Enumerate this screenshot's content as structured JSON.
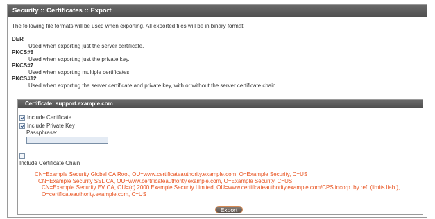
{
  "header": {
    "title": "Security :: Certificates :: Export"
  },
  "intro": "The following file formats will be used when exporting. All exported files will be in binary format.",
  "formats": [
    {
      "name": "DER",
      "desc": "Used when exporting just the server certificate."
    },
    {
      "name": "PKCS#8",
      "desc": "Used when exporting just the private key."
    },
    {
      "name": "PKCS#7",
      "desc": "Used when exporting multiple certificates."
    },
    {
      "name": "PKCS#12",
      "desc": "Used when exporting the server certificate and private key, with or without the server certificate chain."
    }
  ],
  "certificate": {
    "header": "Certificate: support.example.com",
    "include_certificate": {
      "label": "Include Certificate",
      "checked": true
    },
    "include_private_key": {
      "label": "Include Private Key",
      "checked": true
    },
    "passphrase_label": "Passphrase:",
    "passphrase_value": "",
    "include_chain": {
      "label": "Include Certificate Chain",
      "checked": false
    },
    "chain": [
      "CN=Example Security Global CA Root, OU=www.certificateauthority.example.com, O=Example Security, C=US",
      "CN=Example Security SSL CA, OU=www.certificateauthority.example.com, O=Example Security, C=US",
      "CN=Example Security EV CA, OU=(c) 2000 Example Security Limited, OU=www.certificateauthority.example.com/CPS incorp. by ref. (limits liab.),",
      "O=certificateauthority.example.com, C=US"
    ],
    "export_label": "Export"
  },
  "colors": {
    "chain_text": "#e8521f",
    "header_bg": "#555555"
  }
}
